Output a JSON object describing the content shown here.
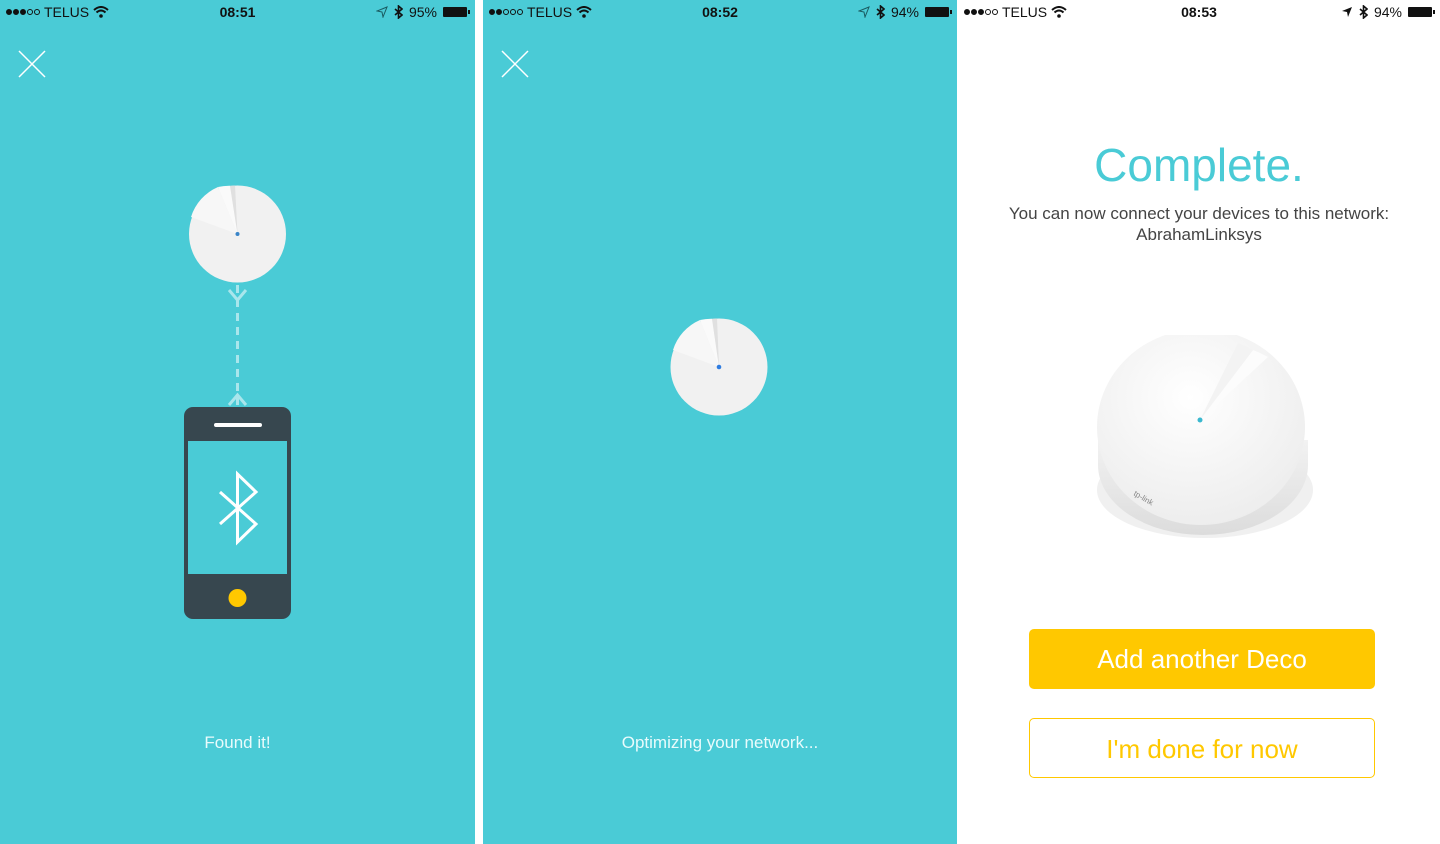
{
  "panels": [
    {
      "status": {
        "signal_filled": 3,
        "signal_total": 5,
        "carrier": "TELUS",
        "time": "08:51",
        "battery": "95%"
      },
      "caption": "Found it!",
      "colors": {
        "background": "#4acbd6",
        "phone_body": "#37474f",
        "home_button": "#ffc800"
      }
    },
    {
      "status": {
        "signal_filled": 2,
        "signal_total": 5,
        "carrier": "TELUS",
        "time": "08:52",
        "battery": "94%"
      },
      "caption": "Optimizing your network...",
      "colors": {
        "background": "#4acbd6",
        "led": "#2f7de1"
      }
    },
    {
      "status": {
        "signal_filled": 3,
        "signal_total": 5,
        "carrier": "TELUS",
        "time": "08:53",
        "battery": "94%"
      },
      "title": "Complete.",
      "subtitle": "You can now connect your devices to this network:",
      "network_name": "AbrahamLinksys",
      "device_brand": "tp-link",
      "primary_button": "Add another Deco",
      "secondary_button": "I'm done for now",
      "colors": {
        "title": "#4acbd6",
        "button": "#ffc800"
      }
    }
  ]
}
